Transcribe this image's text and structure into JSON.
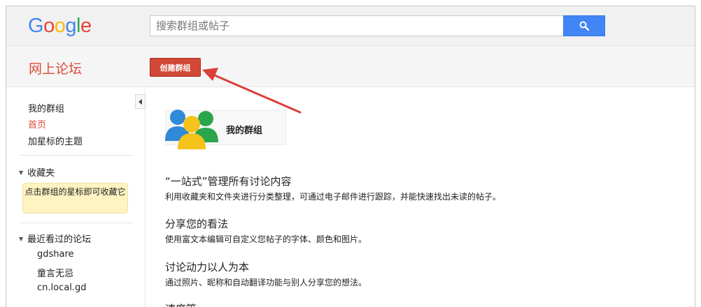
{
  "header": {
    "logo_text": "Google",
    "search": {
      "placeholder": "搜索群组或帖子",
      "value": ""
    },
    "search_button_icon": "search-icon"
  },
  "subheader": {
    "forum_title": "网上论坛",
    "create_group_label": "创建群组"
  },
  "sidebar": {
    "links": [
      {
        "label": "我的群组",
        "active": false
      },
      {
        "label": "首页",
        "active": true
      },
      {
        "label": "加星标的主题",
        "active": false
      }
    ],
    "favorites": {
      "title": "收藏夹",
      "hint": "点击群组的星标即可收藏它"
    },
    "recent": {
      "title": "最近看过的论坛",
      "items": [
        "gdshare",
        "童言无忌",
        "cn.local.gd"
      ]
    }
  },
  "main": {
    "my_groups_card_label": "我的群组",
    "features": [
      {
        "title": "“一站式”管理所有讨论内容",
        "desc": "利用收藏夹和文件夹进行分类整理，可通过电子邮件进行跟踪，并能快速找出未读的帖子。"
      },
      {
        "title": "分享您的看法",
        "desc": "使用富文本编辑可自定义您帖子的字体、颜色和图片。"
      },
      {
        "title": "讨论动力以人为本",
        "desc": "通过照片、昵称和自动翻译功能与别人分享您的想法。"
      },
      {
        "title": "速度等",
        "desc": ""
      }
    ]
  },
  "colors": {
    "accent_red": "#dd4b39",
    "button_red": "#d14836",
    "search_blue": "#4285f4",
    "annotation_arrow": "#d9403a"
  }
}
